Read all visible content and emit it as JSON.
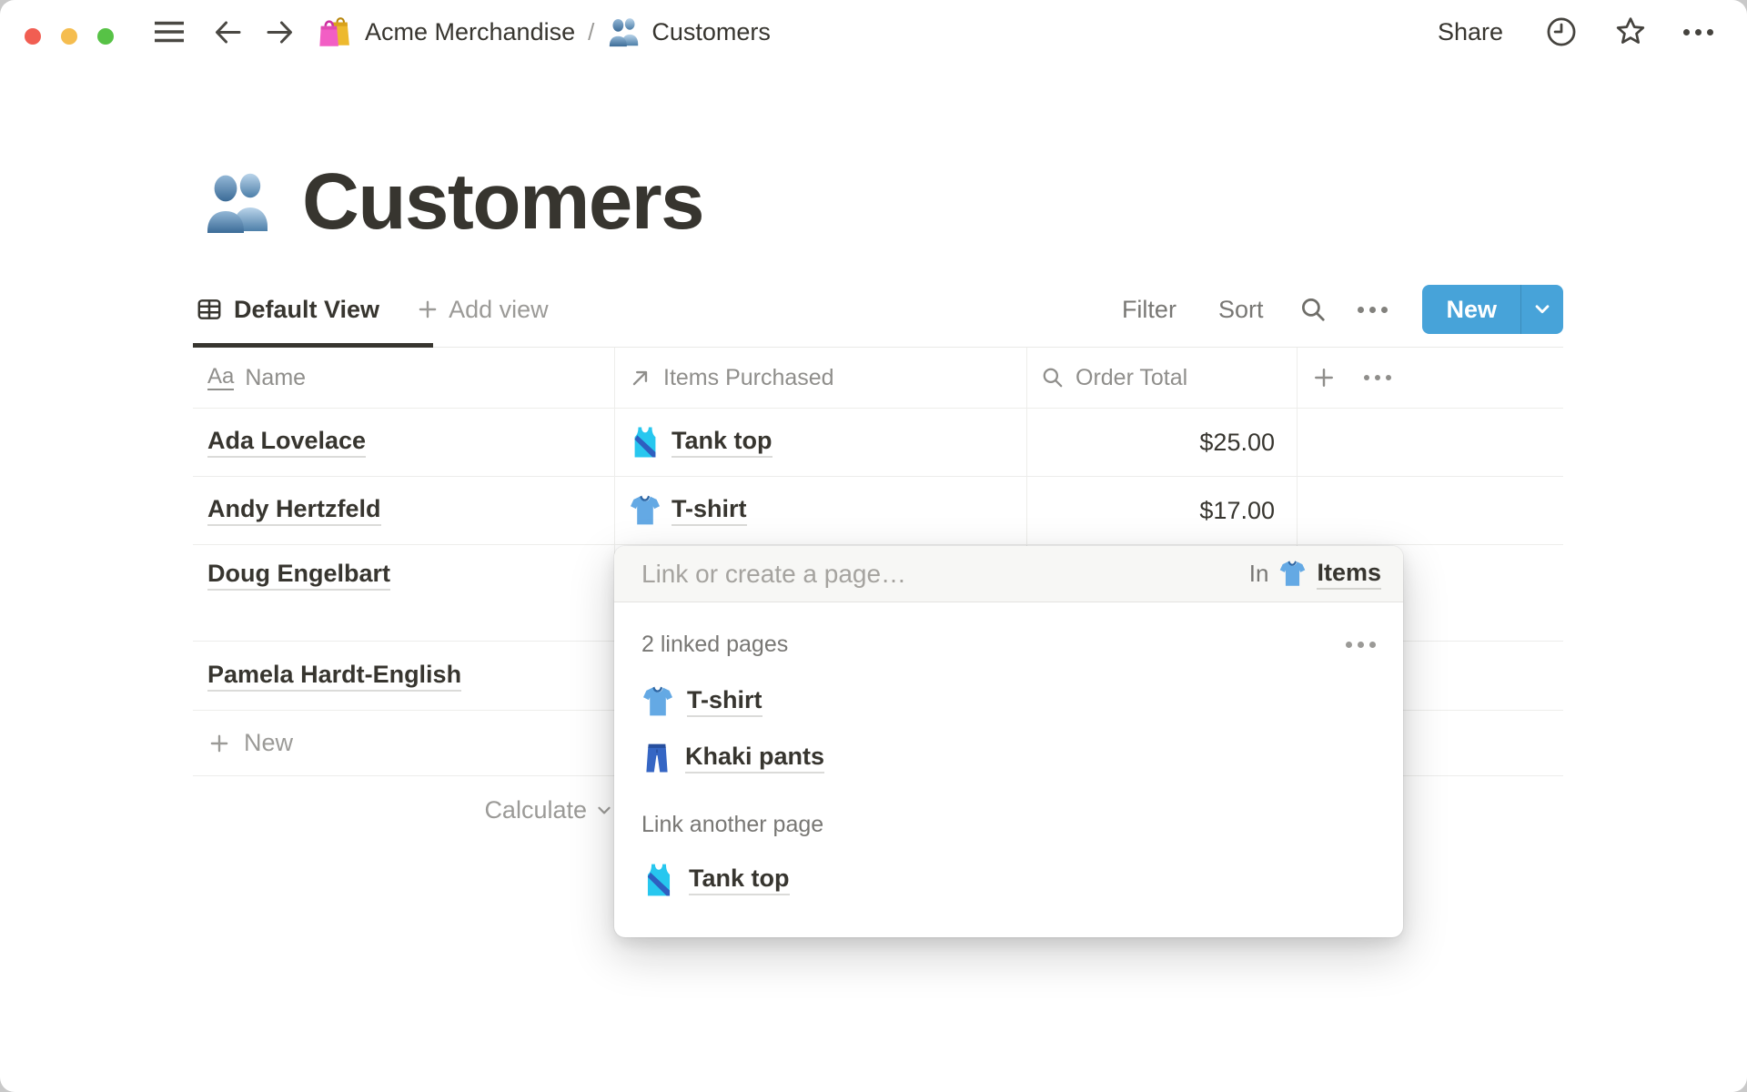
{
  "topbar": {
    "breadcrumb": {
      "workspace": "Acme Merchandise",
      "separator": "/",
      "page": "Customers"
    },
    "share_label": "Share"
  },
  "page": {
    "title": "Customers"
  },
  "toolbar": {
    "active_view_label": "Default View",
    "add_view_label": "Add view",
    "filter_label": "Filter",
    "sort_label": "Sort",
    "new_label": "New"
  },
  "table": {
    "columns": [
      {
        "label": "Name",
        "icon": "text-property-icon"
      },
      {
        "label": "Items Purchased",
        "icon": "relation-icon"
      },
      {
        "label": "Order Total",
        "icon": "rollup-icon"
      }
    ],
    "rows": [
      {
        "name": "Ada Lovelace",
        "item": "Tank top",
        "item_icon": "tank-top-icon",
        "total": "$25.00"
      },
      {
        "name": "Andy Hertzfeld",
        "item": "T-shirt",
        "item_icon": "t-shirt-icon",
        "total": "$17.00"
      },
      {
        "name": "Doug Engelbart"
      },
      {
        "name": "Pamela Hardt-English"
      }
    ],
    "new_row_label": "New",
    "calculate_label": "Calculate"
  },
  "popup": {
    "placeholder": "Link or create a page…",
    "scope_prefix": "In",
    "scope_target": "Items",
    "scope_icon": "t-shirt-icon",
    "linked_section_label": "2 linked pages",
    "linked_pages": [
      {
        "label": "T-shirt",
        "icon": "t-shirt-icon"
      },
      {
        "label": "Khaki pants",
        "icon": "jeans-icon"
      }
    ],
    "link_another_label": "Link another page",
    "suggestions": [
      {
        "label": "Tank top",
        "icon": "tank-top-icon"
      }
    ]
  },
  "colors": {
    "accent_blue": "#47a3d9",
    "text": "#37352f",
    "muted_text": "#787774",
    "faint_text": "#9b9a97",
    "divider": "#ededeb",
    "traffic_red": "#f15e52",
    "traffic_yellow": "#f5bd4f",
    "traffic_green": "#57c246"
  }
}
